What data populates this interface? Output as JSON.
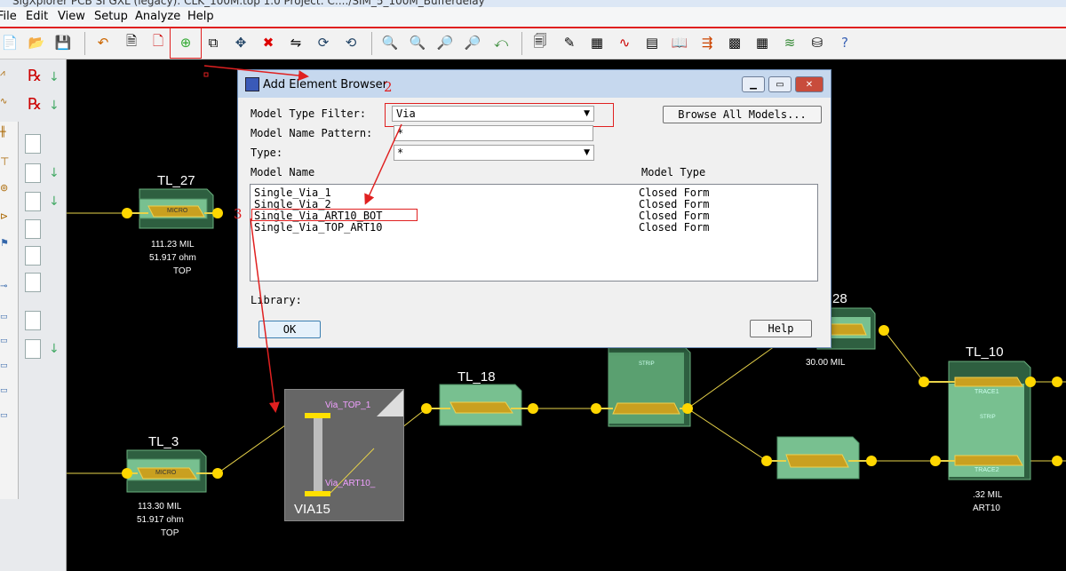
{
  "window_title": "SigXplorer PCB SI GXL (legacy): CLK_100M.top 1.0  Project: C:.../SIM_5_100M_Bufferdelay",
  "menu": [
    "File",
    "Edit",
    "View",
    "Setup",
    "Analyze",
    "Help"
  ],
  "toolbar_icons": [
    "new-icon",
    "open-icon",
    "save-icon",
    "undo-icon",
    "page-icon",
    "delete-page-icon",
    "add-element-icon",
    "copy-icon",
    "move-icon",
    "delete-icon",
    "mirror-icon",
    "rotate-icon",
    "rotate2-icon",
    "zoom-fit-icon",
    "zoom-window-icon",
    "zoom-in-icon",
    "zoom-out-icon",
    "zoom-prev-icon",
    "properties-icon",
    "edit-icon",
    "sweep-icon",
    "waveform-icon",
    "stimulus-icon",
    "book-icon",
    "export-icon",
    "report-icon",
    "calc-icon",
    "spreadsheet-icon",
    "layers-icon",
    "stack-icon",
    "help-icon"
  ],
  "dialog": {
    "title": "Add Element Browser",
    "model_type_filter_label": "Model Type Filter:",
    "model_type_filter_value": "Via",
    "browse_all_label": "Browse All Models...",
    "model_name_pattern_label": "Model Name Pattern:",
    "model_name_pattern_value": "*",
    "type_label": "Type:",
    "type_value": "*",
    "col_model_name": "Model Name",
    "col_model_type": "Model Type",
    "rows": [
      {
        "name": "Single_Via_1",
        "type": "Closed Form"
      },
      {
        "name": "Single_Via_2",
        "type": "Closed Form"
      },
      {
        "name": "Single_Via_ART10_BOT",
        "type": "Closed Form"
      },
      {
        "name": "Single_Via_TOP_ART10",
        "type": "Closed Form"
      }
    ],
    "library_label": "Library:",
    "ok_label": "OK",
    "help_label": "Help"
  },
  "annotations": {
    "num2": "2",
    "num3": "3"
  },
  "canvas": {
    "tl27": {
      "name": "TL_27",
      "inner": "MICRO",
      "length": "111.23 MIL",
      "impedance": "51.917 ohm",
      "layer": "TOP"
    },
    "tl3": {
      "name": "TL_3",
      "inner": "MICRO",
      "length": "113.30 MIL",
      "impedance": "51.917 ohm",
      "layer": "TOP"
    },
    "tl18": {
      "name": "TL_18"
    },
    "tl28": {
      "name": "28",
      "length": "30.00 MIL"
    },
    "tl10": {
      "name": "TL_10",
      "trace1": "TRACE1",
      "strip": "STRIP",
      "trace2": "TRACE2",
      "length": ".32 MIL",
      "layer": "ART10"
    },
    "strip_mid": "STRIP",
    "via15": {
      "name": "VIA15",
      "top_pin": "Via_TOP_1",
      "bot_pin": "Via_ART10_"
    }
  }
}
